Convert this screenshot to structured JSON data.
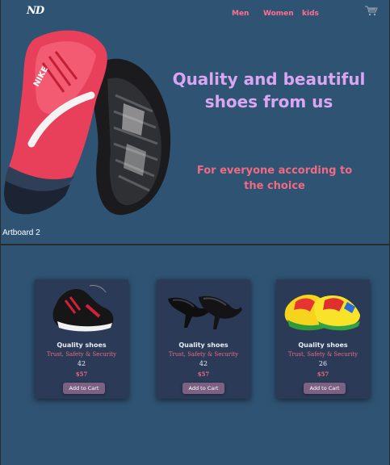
{
  "header": {
    "logo": "ND",
    "nav": [
      {
        "label": "Men"
      },
      {
        "label": "Women"
      },
      {
        "label": "kids"
      }
    ],
    "cart_icon": "shopping-cart-icon"
  },
  "hero": {
    "title": "Quality and beautiful shoes from us",
    "subtitle": "For everyone according to the choice",
    "image": "running-shoes-image"
  },
  "artboard_label": "Artboard 2",
  "products": [
    {
      "name": "Quality shoes",
      "tagline": "Trust, Safety & Security",
      "size": "42",
      "price": "$57",
      "button": "Add to Cart",
      "image": "sneaker-image"
    },
    {
      "name": "Quality shoes",
      "tagline": "Trust, Safety & Security",
      "size": "42",
      "price": "$57",
      "button": "Add to Cart",
      "image": "heels-image"
    },
    {
      "name": "Quality shoes",
      "tagline": "Trust, Safety & Security",
      "size": "26",
      "price": "$57",
      "button": "Add to Cart",
      "image": "kids-shoes-image"
    }
  ],
  "colors": {
    "background": "#2f5373",
    "card": "#2a3a57",
    "accent_pink": "#f06a82",
    "title_lavender": "#d9a6f2",
    "button": "#7d6182"
  }
}
